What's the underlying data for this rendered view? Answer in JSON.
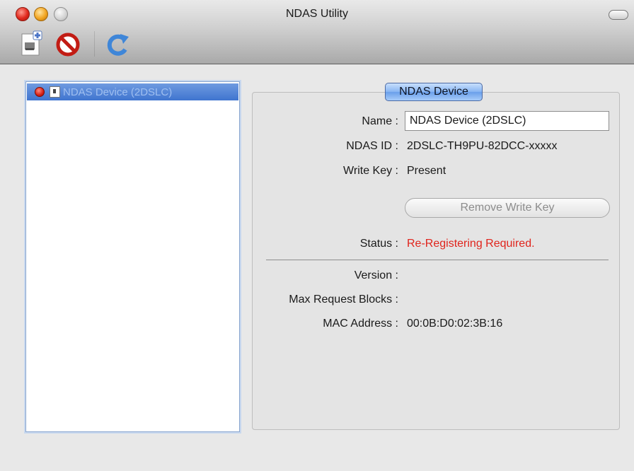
{
  "window": {
    "title": "NDAS Utility"
  },
  "toolbar": {
    "buttons": [
      {
        "name": "add-device",
        "icon": "add-document-icon"
      },
      {
        "name": "unregister-device",
        "icon": "prohibited-icon"
      },
      {
        "name": "refresh",
        "icon": "refresh-icon"
      }
    ]
  },
  "device_list": {
    "items": [
      {
        "label": "NDAS Device (2DSLC)",
        "status_color": "#d41f14",
        "selected": true
      }
    ]
  },
  "details": {
    "group_title": "NDAS Device",
    "name_label": "Name :",
    "name_value": "NDAS Device (2DSLC)",
    "ndas_id_label": "NDAS ID :",
    "ndas_id_value": "2DSLC-TH9PU-82DCC-xxxxx",
    "write_key_label": "Write Key :",
    "write_key_value": "Present",
    "remove_write_key_label": "Remove Write Key",
    "status_label": "Status :",
    "status_value": "Re-Registering Required.",
    "status_color": "#e0241c",
    "version_label": "Version :",
    "version_value": "",
    "max_request_blocks_label": "Max Request Blocks :",
    "max_request_blocks_value": "",
    "mac_address_label": "MAC Address :",
    "mac_address_value": "00:0B:D0:02:3B:16"
  }
}
